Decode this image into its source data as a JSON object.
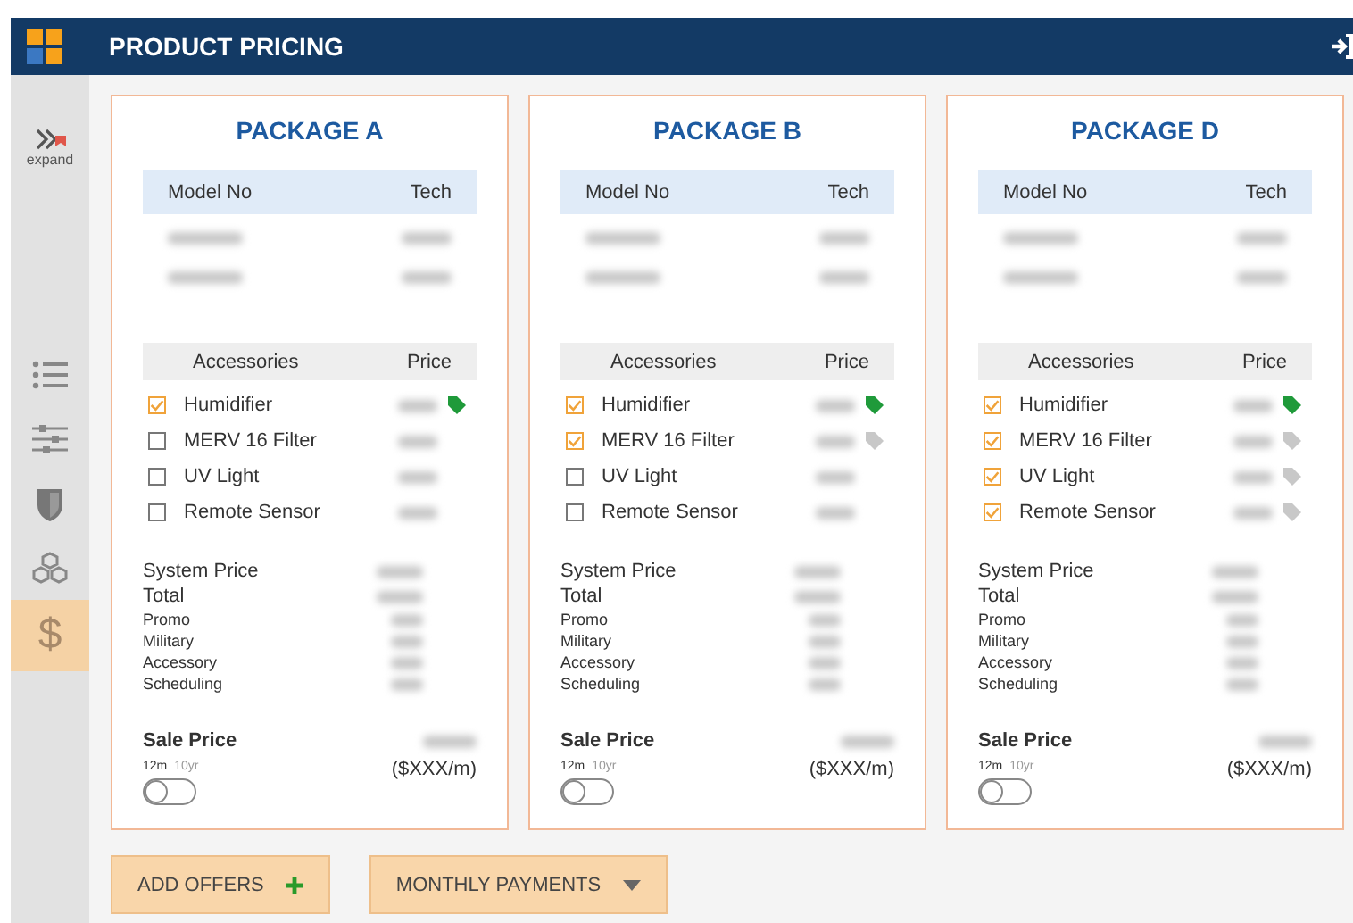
{
  "header": {
    "title": "PRODUCT PRICING"
  },
  "sidebar": {
    "items": [
      {
        "kind": "expand",
        "label": "expand",
        "selected": false
      },
      {
        "kind": "list",
        "selected": false
      },
      {
        "kind": "sliders",
        "selected": false
      },
      {
        "kind": "shield",
        "selected": false
      },
      {
        "kind": "cubes",
        "selected": false
      },
      {
        "kind": "dollar",
        "glyph": "$",
        "selected": true
      }
    ]
  },
  "packages": [
    {
      "title": "PACKAGE A",
      "model_columns": [
        "Model No",
        "Tech"
      ],
      "accessory_columns": [
        "Accessories",
        "Price"
      ],
      "accessories": [
        {
          "name": "Humidifier",
          "checked": true,
          "color": "#1f9a3a"
        },
        {
          "name": "MERV 16 Filter",
          "checked": false
        },
        {
          "name": "UV Light",
          "checked": false
        },
        {
          "name": "Remote Sensor",
          "checked": false
        }
      ],
      "totals": [
        {
          "label": "System Price",
          "kind": "main"
        },
        {
          "label": "Total",
          "kind": "main"
        },
        {
          "label": "Promo",
          "kind": "minor"
        },
        {
          "label": "Military",
          "kind": "minor"
        },
        {
          "label": "Accessory",
          "kind": "minor"
        },
        {
          "label": "Scheduling",
          "kind": "minor"
        }
      ],
      "sale_label": "Sale Price",
      "terms": [
        {
          "label": "12m",
          "selected": true
        },
        {
          "label": "10yr",
          "selected": false
        }
      ],
      "toggle_on": false,
      "monthly": "($XXX/m)"
    },
    {
      "title": "PACKAGE B",
      "model_columns": [
        "Model No",
        "Tech"
      ],
      "accessory_columns": [
        "Accessories",
        "Price"
      ],
      "accessories": [
        {
          "name": "Humidifier",
          "checked": true,
          "color": "#1f9a3a"
        },
        {
          "name": "MERV 16 Filter",
          "checked": true,
          "color": "#c8c8c8"
        },
        {
          "name": "UV Light",
          "checked": false
        },
        {
          "name": "Remote Sensor",
          "checked": false
        }
      ],
      "totals": [
        {
          "label": "System Price",
          "kind": "main"
        },
        {
          "label": "Total",
          "kind": "main"
        },
        {
          "label": "Promo",
          "kind": "minor"
        },
        {
          "label": "Military",
          "kind": "minor"
        },
        {
          "label": "Accessory",
          "kind": "minor"
        },
        {
          "label": "Scheduling",
          "kind": "minor"
        }
      ],
      "sale_label": "Sale Price",
      "terms": [
        {
          "label": "12m",
          "selected": true
        },
        {
          "label": "10yr",
          "selected": false
        }
      ],
      "toggle_on": false,
      "monthly": "($XXX/m)"
    },
    {
      "title": "PACKAGE D",
      "model_columns": [
        "Model No",
        "Tech"
      ],
      "accessory_columns": [
        "Accessories",
        "Price"
      ],
      "accessories": [
        {
          "name": "Humidifier",
          "checked": true,
          "color": "#1f9a3a"
        },
        {
          "name": "MERV 16 Filter",
          "checked": true,
          "color": "#c8c8c8"
        },
        {
          "name": "UV Light",
          "checked": true,
          "color": "#c8c8c8"
        },
        {
          "name": "Remote Sensor",
          "checked": true,
          "color": "#c8c8c8"
        }
      ],
      "totals": [
        {
          "label": "System Price",
          "kind": "main"
        },
        {
          "label": "Total",
          "kind": "main"
        },
        {
          "label": "Promo",
          "kind": "minor"
        },
        {
          "label": "Military",
          "kind": "minor"
        },
        {
          "label": "Accessory",
          "kind": "minor"
        },
        {
          "label": "Scheduling",
          "kind": "minor"
        }
      ],
      "sale_label": "Sale Price",
      "terms": [
        {
          "label": "12m",
          "selected": true
        },
        {
          "label": "10yr",
          "selected": false
        }
      ],
      "toggle_on": false,
      "monthly": "($XXX/m)"
    }
  ],
  "actions": [
    {
      "label": "ADD OFFERS",
      "kind": "add"
    },
    {
      "label": "MONTHLY PAYMENTS",
      "kind": "dropdown"
    }
  ]
}
